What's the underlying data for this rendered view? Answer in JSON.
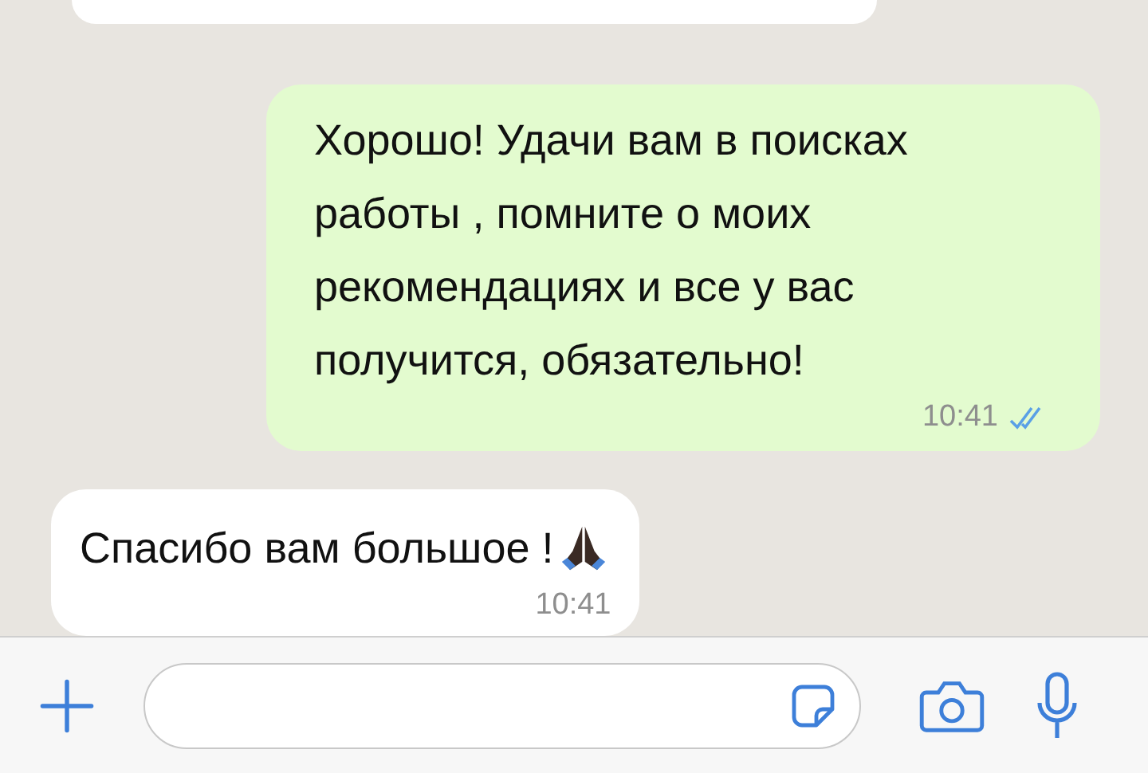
{
  "messages": [
    {
      "kind": "incoming"
    },
    {
      "kind": "outgoing",
      "text": "Хорошо! Удачи вам в поисках работы , помните о моих рекомендациях и все у вас получится, обязательно!",
      "time": "10:41",
      "read": true
    },
    {
      "kind": "incoming",
      "text": "Спасибо вам большое !",
      "emoji": true,
      "time": "10:41"
    }
  ]
}
